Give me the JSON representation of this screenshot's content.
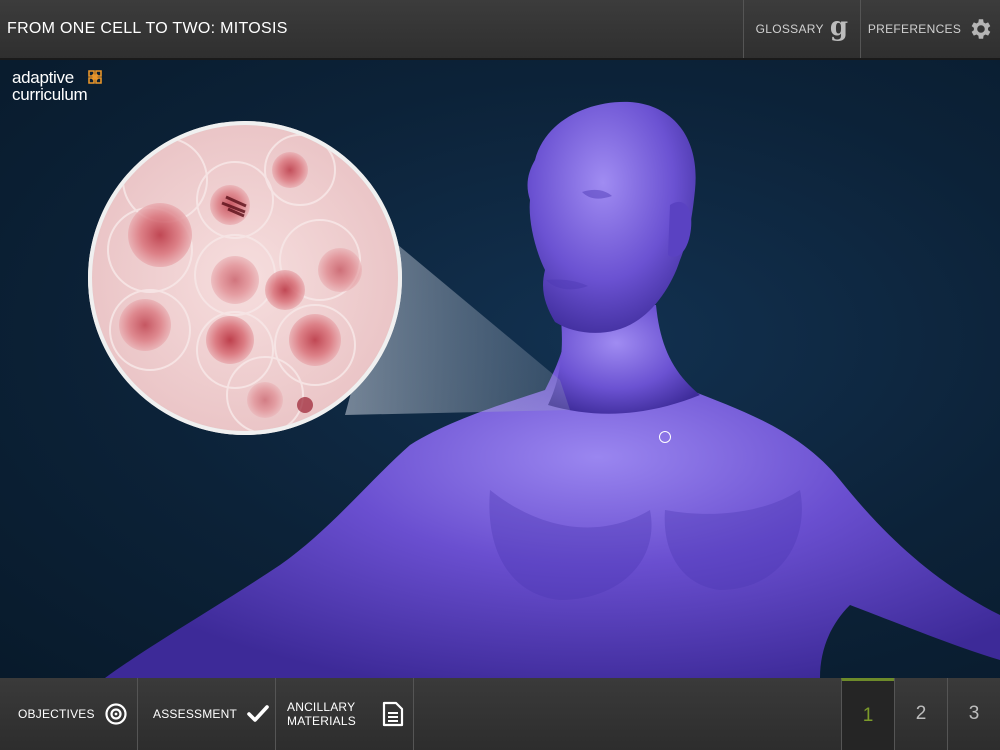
{
  "header": {
    "title": "FROM ONE CELL TO TWO: MITOSIS",
    "glossary_label": "GLOSSARY",
    "preferences_label": "PREFERENCES"
  },
  "logo": {
    "line1": "adaptive",
    "line2": "curriculum"
  },
  "footer": {
    "objectives_label": "OBJECTIVES",
    "assessment_label": "ASSESSMENT",
    "ancillary_line1": "ANCILLARY",
    "ancillary_line2": "MATERIALS",
    "pages": [
      "1",
      "2",
      "3"
    ],
    "active_page": "1"
  },
  "colors": {
    "accent": "#7c9b2a",
    "logo_orange": "#e8952a",
    "figure_purple": "#6a4fd0",
    "background": "#0c2238"
  },
  "icons": {
    "glossary": "glossary-g-icon",
    "preferences": "gear-icon",
    "objectives": "target-icon",
    "assessment": "checkmark-icon",
    "ancillary": "document-icon",
    "logo": "puzzle-icon"
  }
}
